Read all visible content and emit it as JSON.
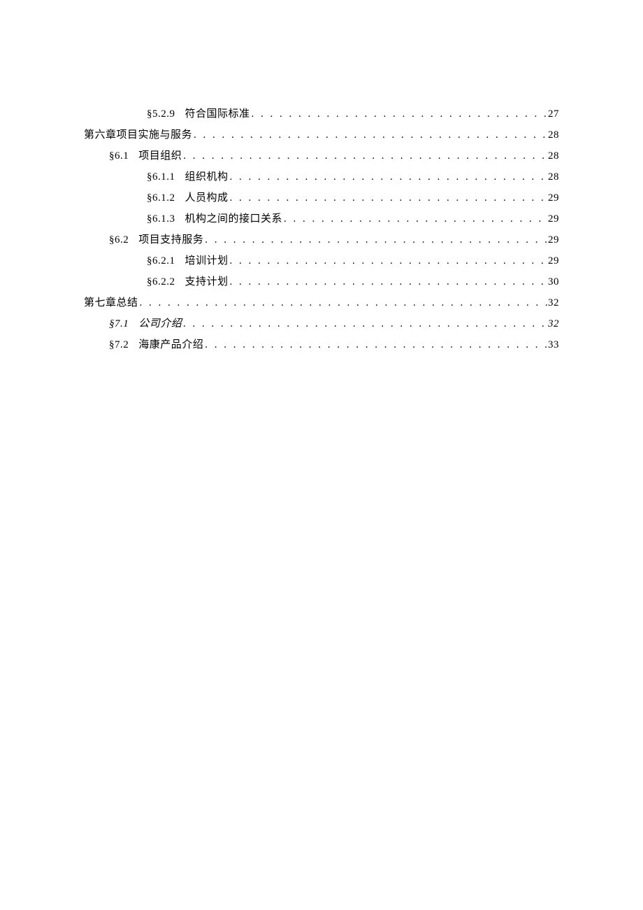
{
  "toc": {
    "entries": [
      {
        "level": 3,
        "prefix": "§5.2.9",
        "title": "符合国际标准",
        "page": "27",
        "italic": false
      },
      {
        "level": 1,
        "prefix": "",
        "title": "第六章项目实施与服务",
        "page": "28",
        "italic": false
      },
      {
        "level": 2,
        "prefix": "§6.1",
        "title": "项目组织",
        "page": "28",
        "italic": false
      },
      {
        "level": 3,
        "prefix": "§6.1.1",
        "title": "组织机构",
        "page": "28",
        "italic": false
      },
      {
        "level": 3,
        "prefix": "§6.1.2",
        "title": "人员构成",
        "page": "29",
        "italic": false
      },
      {
        "level": 3,
        "prefix": "§6.1.3",
        "title": "机构之间的接口关系",
        "page": "29",
        "italic": false
      },
      {
        "level": 2,
        "prefix": "§6.2",
        "title": "项目支持服务",
        "page": "29",
        "italic": false
      },
      {
        "level": 3,
        "prefix": "§6.2.1",
        "title": "培训计划",
        "page": "29",
        "italic": false
      },
      {
        "level": 3,
        "prefix": "§6.2.2",
        "title": "支持计划",
        "page": "30",
        "italic": false
      },
      {
        "level": 1,
        "prefix": "",
        "title": "第七章总结",
        "page": "32",
        "italic": false
      },
      {
        "level": 2,
        "prefix": "§7.1",
        "title": "公司介绍",
        "page": "32",
        "italic": true
      },
      {
        "level": 2,
        "prefix": "§7.2",
        "title": "海康产品介绍",
        "page": "33",
        "italic": false
      }
    ]
  }
}
